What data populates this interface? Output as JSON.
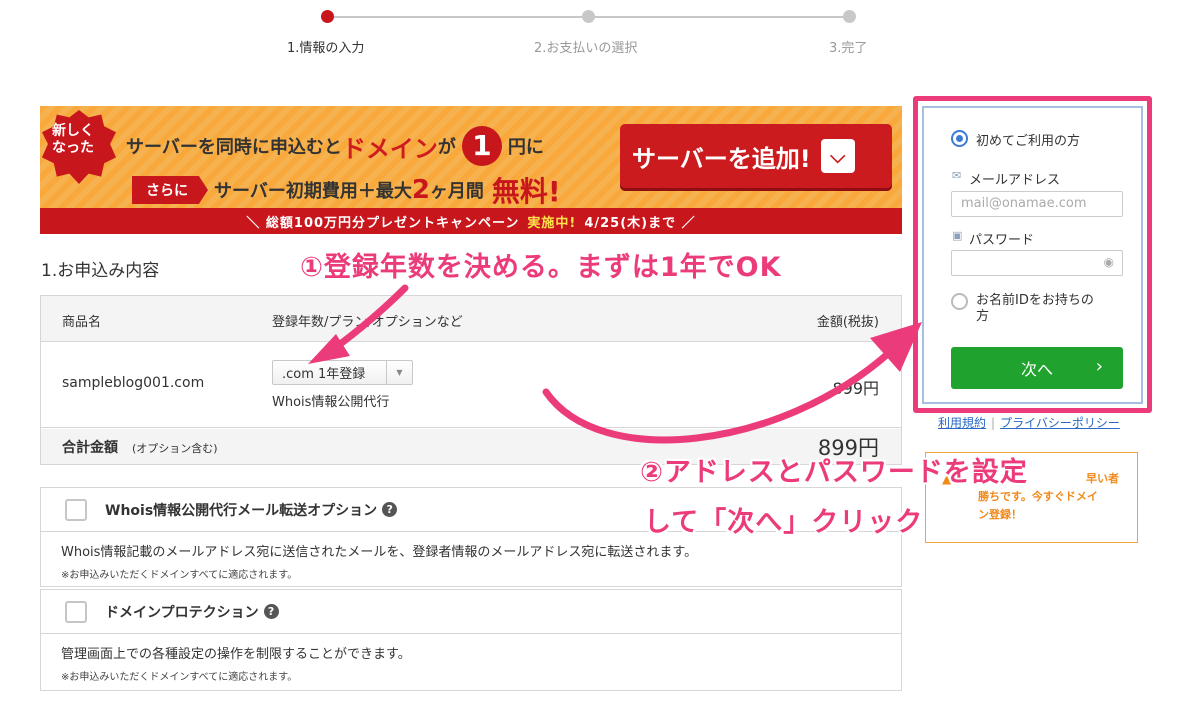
{
  "steps": [
    "1.情報の入力",
    "2.お支払いの選択",
    "3.完了"
  ],
  "banner": {
    "badge": [
      "新しく",
      "なった"
    ],
    "line1_a": "サーバーを同時に申込むと",
    "line1_domain": "ドメイン",
    "line1_ga": "が",
    "line1_one": "1",
    "line1_yen": "円に",
    "sarani": "さらに",
    "line2_a": "サーバー初期費用＋最大",
    "line2_num": "2",
    "line2_unit": "ヶ月間",
    "line2_free": "無料!",
    "add_button": "サーバーを追加!",
    "strip_a": "＼ 総額100万円分プレゼントキャンペーン",
    "strip_b": "実施中!",
    "strip_c": "4/25(木)まで ／"
  },
  "section_title": "1.お申込み内容",
  "table": {
    "headers": [
      "商品名",
      "登録年数/プラン/オプションなど",
      "金額(税抜)"
    ],
    "row": {
      "name": "sampleblog001.com",
      "plan_select": ".com 1年登録",
      "plan_sub": "Whois情報公開代行",
      "price": "899円"
    },
    "total_label": "合計金額",
    "total_sub": "(オプション含む)",
    "total_price": "899円"
  },
  "options": [
    {
      "title": "Whois情報公開代行メール転送オプション",
      "desc": "Whois情報記載のメールアドレス宛に送信されたメールを、登録者情報のメールアドレス宛に転送されます。",
      "note": "※お申込みいただくドメインすべてに適応されます。"
    },
    {
      "title": "ドメインプロテクション",
      "desc": "管理画面上での各種設定の操作を制限することができます。",
      "note": "※お申込みいただくドメインすべてに適応されます。"
    }
  ],
  "login": {
    "first_time": "初めてご利用の方",
    "email_label": "メールアドレス",
    "email_placeholder": "mail@onamae.com",
    "password_label": "パスワード",
    "have_id": [
      "お名前IDをお持ちの",
      "方"
    ],
    "next": "次へ",
    "terms": "利用規約",
    "privacy": "プライバシーポリシー"
  },
  "side_note": [
    "早い者",
    "勝ちです。今すぐドメイ",
    "ン登録！"
  ],
  "annotations": {
    "a1": "①登録年数を決める。まずは1年でOK",
    "a2_l1": "②アドレスとパスワードを設定",
    "a2_l2": "して「次へ」クリック"
  },
  "colors": {
    "accent": "#ec3b7a",
    "red": "#c8161d",
    "green": "#1fa22e",
    "orange": "#f9a93c"
  }
}
